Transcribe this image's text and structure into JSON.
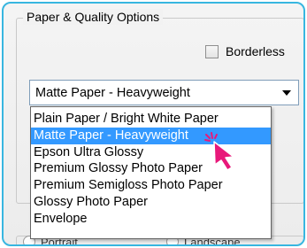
{
  "paper_quality": {
    "group_title": "Paper & Quality Options",
    "borderless_label": "Borderless",
    "borderless_checked": false,
    "selected_value": "Matte Paper - Heavyweight",
    "options": [
      "Plain Paper / Bright White Paper",
      "Matte Paper - Heavyweight",
      "Epson Ultra Glossy",
      "Premium Glossy Photo Paper",
      "Premium Semigloss Photo Paper",
      "Glossy Photo Paper",
      "Envelope"
    ],
    "highlighted_index": 1
  },
  "orientation": {
    "portrait_label": "Portrait",
    "landscape_label": "Landscape"
  },
  "colors": {
    "frame_border": "#38b6e0",
    "highlight": "#3399ff",
    "cursor": "#e8187a"
  },
  "icons": {
    "cursor": "pointer-arrow-icon",
    "dropdown": "chevron-down-icon"
  }
}
